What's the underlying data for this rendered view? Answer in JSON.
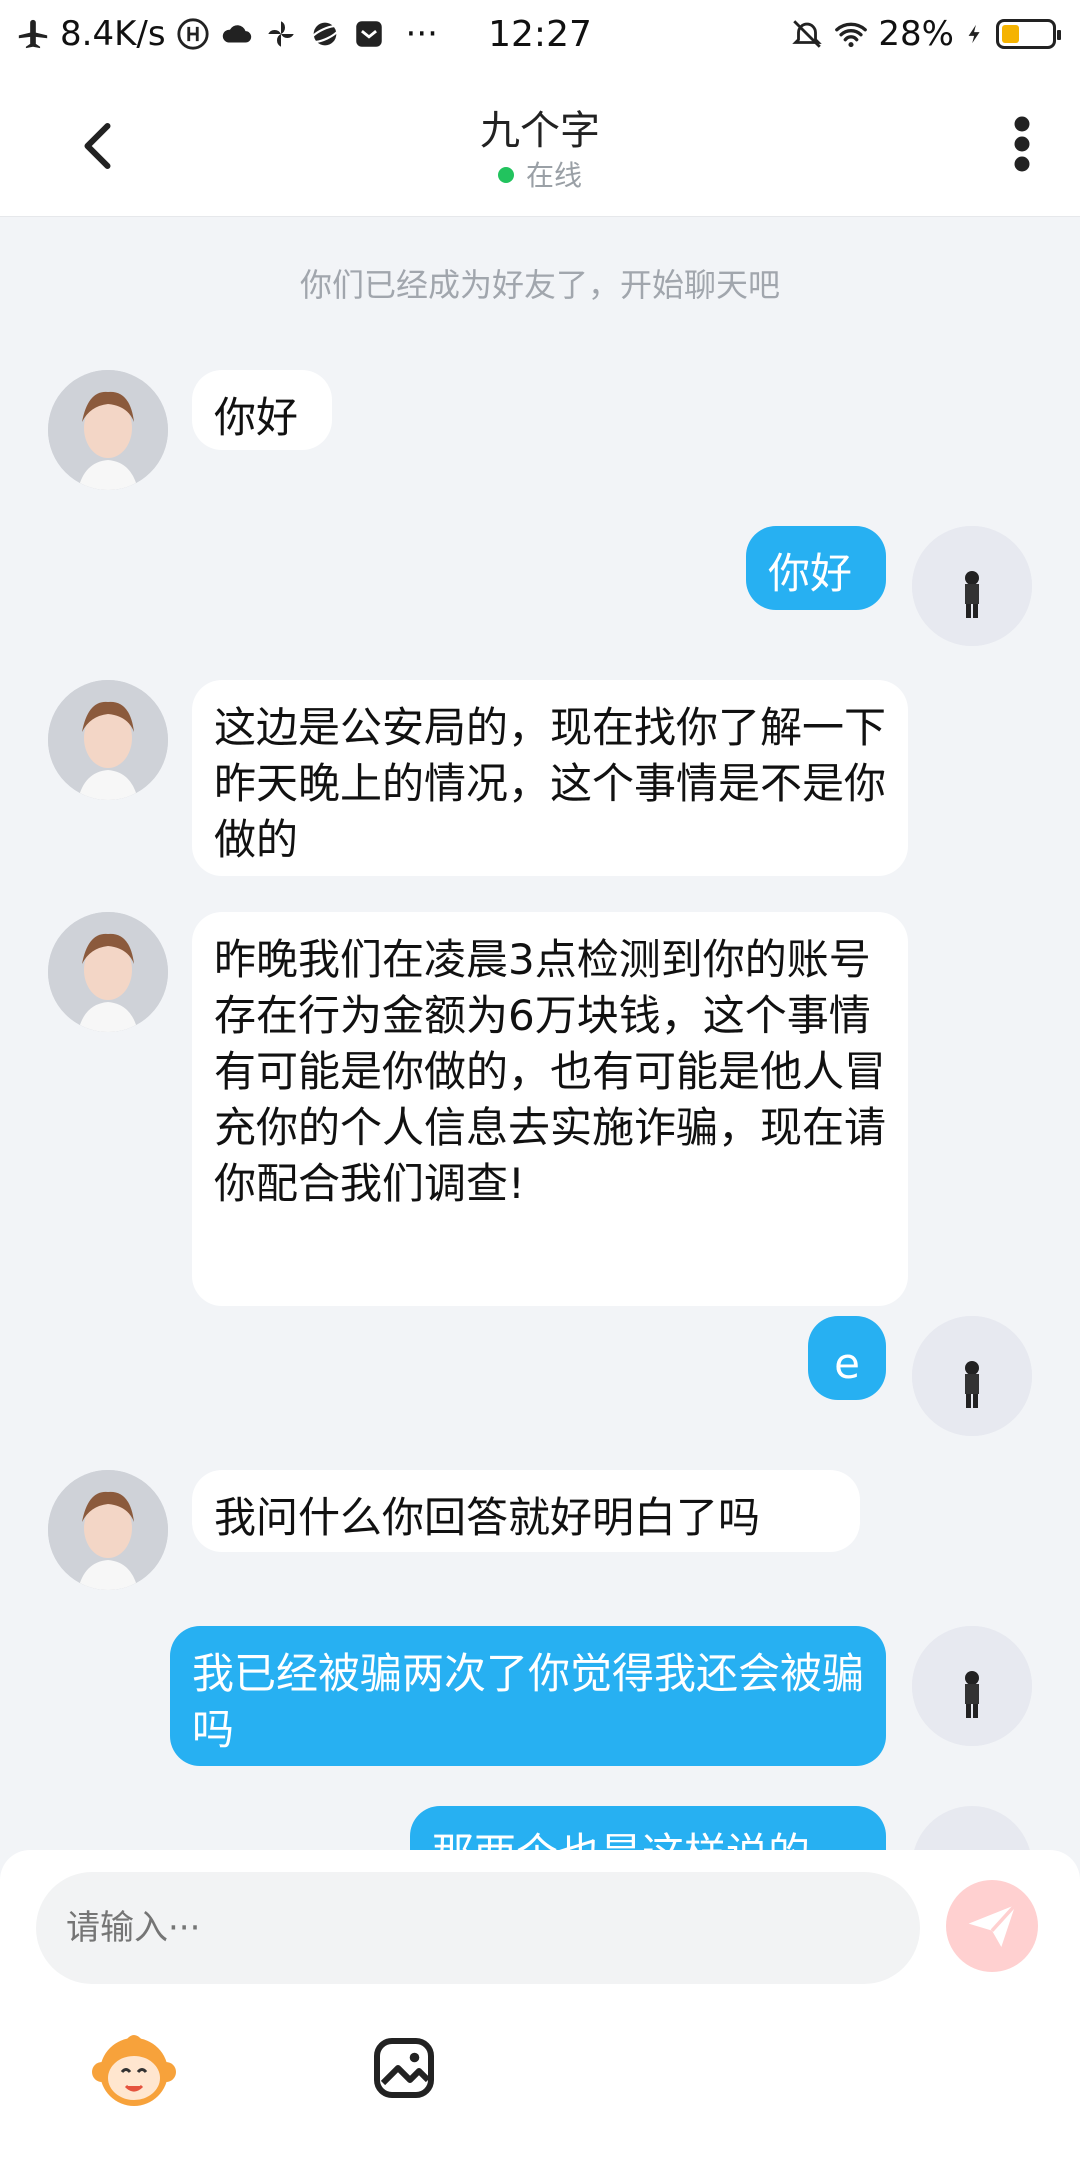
{
  "status_bar": {
    "network_speed": "8.4K/s",
    "time": "12:27",
    "battery": "28%",
    "more": "···"
  },
  "header": {
    "title": "九个字",
    "presence": "在线"
  },
  "chat": {
    "system_note": "你们已经成为好友了，开始聊天吧",
    "messages": [
      {
        "from": "other",
        "text": "你好"
      },
      {
        "from": "self",
        "text": "你好"
      },
      {
        "from": "other",
        "text": "这边是公安局的，现在找你了解一下昨天晚上的情况，这个事情是不是你做的"
      },
      {
        "from": "other",
        "text": "昨晚我们在凌晨3点检测到你的账号存在行为金额为6万块钱，这个事情有可能是你做的，也有可能是他人冒充你的个人信息去实施诈骗，现在请你配合我们调查!"
      },
      {
        "from": "self",
        "text": "e"
      },
      {
        "from": "other",
        "text": "我问什么你回答就好明白了吗"
      },
      {
        "from": "self",
        "text": "我已经被骗两次了你觉得我还会被骗吗"
      },
      {
        "from": "self",
        "text": "那两个也是这样说的"
      }
    ]
  },
  "composer": {
    "placeholder": "请输入···"
  },
  "colors": {
    "outgoing_bubble": "#27b0f2",
    "incoming_bubble": "#ffffff",
    "background": "#f2f4f7",
    "online_dot": "#22c35e"
  },
  "icons": [
    "airplane-icon",
    "wifi-icon",
    "battery-icon",
    "back-arrow-icon",
    "more-vertical-icon",
    "send-icon",
    "emoji-monkey-icon",
    "image-icon"
  ]
}
